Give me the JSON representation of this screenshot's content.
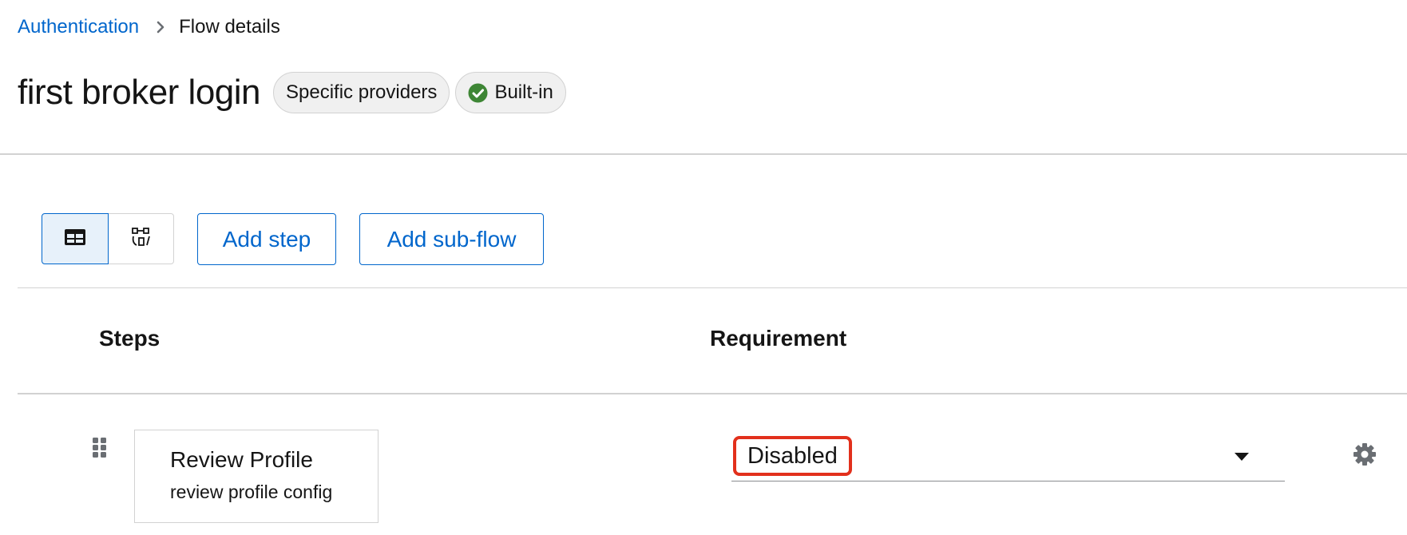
{
  "breadcrumb": {
    "parent": "Authentication",
    "current": "Flow details",
    "separator_icon": "chevron-right-icon"
  },
  "header": {
    "title": "first broker login",
    "labels": {
      "providers": "Specific providers",
      "builtin": "Built-in"
    },
    "builtin_icon": "check-circle-icon",
    "builtin_icon_color": "#3e8635"
  },
  "toolbar": {
    "view_table_icon": "table-icon",
    "view_diagram_icon": "diagram-icon",
    "add_step_label": "Add step",
    "add_subflow_label": "Add sub-flow"
  },
  "table": {
    "columns": {
      "steps": "Steps",
      "requirement": "Requirement"
    },
    "rows": [
      {
        "name": "Review Profile",
        "description": "review profile config",
        "requirement": "Disabled"
      }
    ]
  },
  "colors": {
    "link": "#0066cc",
    "highlight": "#e2301c",
    "border": "#d2d2d2"
  }
}
